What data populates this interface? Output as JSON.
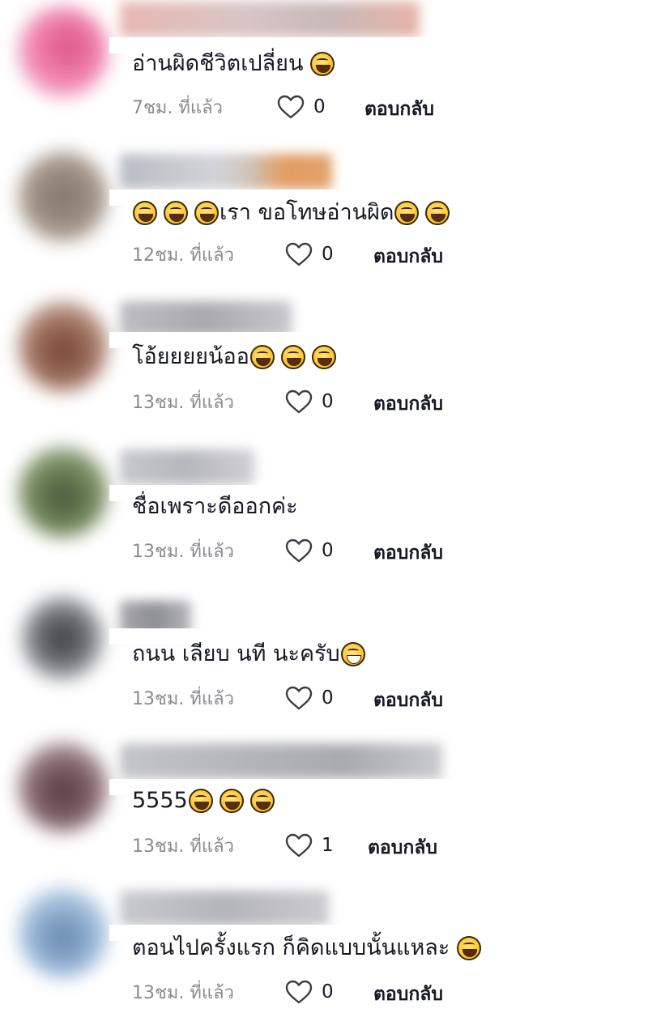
{
  "comments": [
    {
      "text": "อ่านผิดชีวิตเปลี่ยน",
      "emoji_count": 1,
      "emoji_before": 0,
      "time": "7ชม. ที่แล้ว",
      "likes": "0",
      "reply": "ตอบกลับ"
    },
    {
      "text": "เรา ขอโทษอ่านผิด",
      "emoji_count": 2,
      "emoji_before": 3,
      "time": "12ชม. ที่แล้ว",
      "likes": "0",
      "reply": "ตอบกลับ"
    },
    {
      "text": "โอ้ยยยยน้ออ",
      "emoji_count": 3,
      "emoji_before": 0,
      "time": "13ชม. ที่แล้ว",
      "likes": "0",
      "reply": "ตอบกลับ"
    },
    {
      "text": "ชื่อเพราะดีออกค่ะ",
      "emoji_count": 0,
      "emoji_before": 0,
      "time": "13ชม. ที่แล้ว",
      "likes": "0",
      "reply": "ตอบกลับ"
    },
    {
      "text": "ถนน เลียบ นที นะครับ",
      "emoji_count": 1,
      "emoji_before": 0,
      "emoji_style": "grin",
      "time": "13ชม. ที่แล้ว",
      "likes": "0",
      "reply": "ตอบกลับ"
    },
    {
      "text": "5555",
      "emoji_count": 3,
      "emoji_before": 0,
      "time": "13ชม. ที่แล้ว",
      "likes": "1",
      "reply": "ตอบกลับ"
    },
    {
      "text": "ตอนไปครั้งแรก ก็คิดแบบนั้นแหละ",
      "emoji_count": 1,
      "emoji_before": 0,
      "time": "13ชม. ที่แล้ว",
      "likes": "0",
      "reply": "ตอบกลับ"
    }
  ],
  "icons": {
    "emoji": "face-with-tears-of-joy-icon",
    "emoji_grin": "grinning-face-icon",
    "heart": "heart-outline-icon"
  },
  "colors": {
    "muted": "#8a8b91",
    "text": "#161823",
    "background": "#ffffff"
  }
}
